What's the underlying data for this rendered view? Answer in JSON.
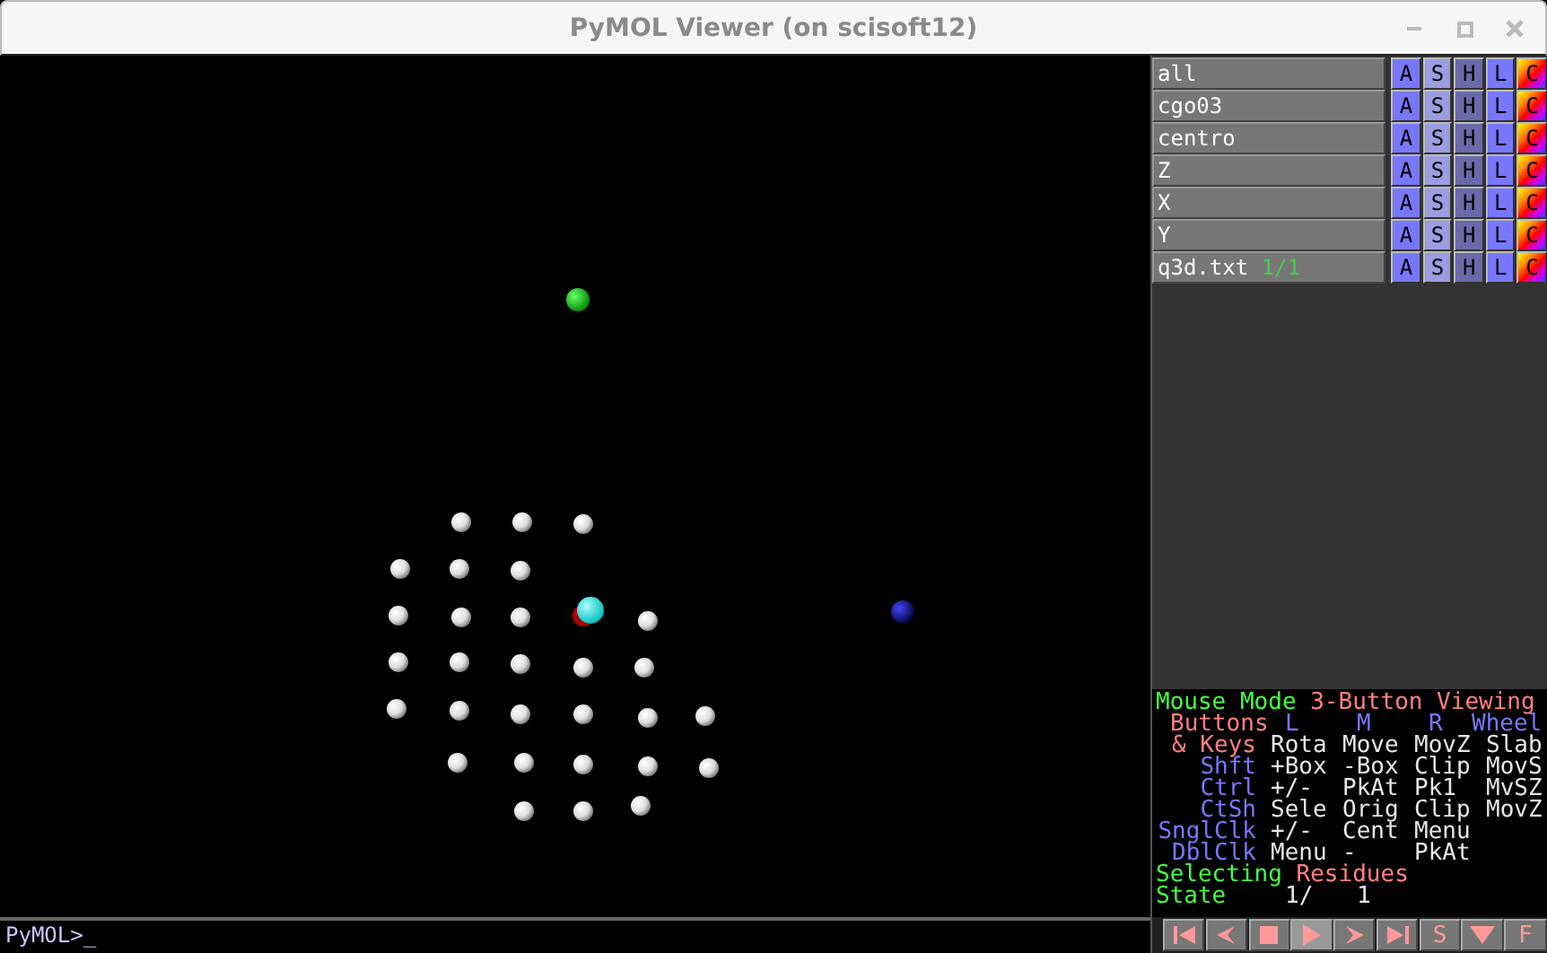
{
  "window": {
    "title": "PyMOL Viewer (on scisoft12)"
  },
  "objects": [
    {
      "name": "all",
      "buttons": [
        {
          "label": "A",
          "kind": "action"
        },
        {
          "label": "S",
          "kind": "show"
        },
        {
          "label": "H",
          "kind": "hide"
        },
        {
          "label": "L",
          "kind": "label"
        },
        {
          "label": "C",
          "kind": "color"
        }
      ]
    },
    {
      "name": "cgo03",
      "buttons": [
        {
          "label": "A",
          "kind": "action"
        },
        {
          "label": "S",
          "kind": "show"
        },
        {
          "label": "H",
          "kind": "hide"
        },
        {
          "label": "L",
          "kind": "label"
        },
        {
          "label": "C",
          "kind": "color"
        }
      ]
    },
    {
      "name": "centro",
      "buttons": [
        {
          "label": "A",
          "kind": "action"
        },
        {
          "label": "S",
          "kind": "show"
        },
        {
          "label": "H",
          "kind": "hide"
        },
        {
          "label": "L",
          "kind": "label"
        },
        {
          "label": "C",
          "kind": "color"
        }
      ]
    },
    {
      "name": "Z",
      "buttons": [
        {
          "label": "A",
          "kind": "action"
        },
        {
          "label": "S",
          "kind": "show"
        },
        {
          "label": "H",
          "kind": "hide"
        },
        {
          "label": "L",
          "kind": "label"
        },
        {
          "label": "C",
          "kind": "color"
        }
      ]
    },
    {
      "name": "X",
      "buttons": [
        {
          "label": "A",
          "kind": "action"
        },
        {
          "label": "S",
          "kind": "show"
        },
        {
          "label": "H",
          "kind": "hide"
        },
        {
          "label": "L",
          "kind": "label"
        },
        {
          "label": "C",
          "kind": "color"
        }
      ]
    },
    {
      "name": "Y",
      "buttons": [
        {
          "label": "A",
          "kind": "action"
        },
        {
          "label": "S",
          "kind": "show"
        },
        {
          "label": "H",
          "kind": "hide"
        },
        {
          "label": "L",
          "kind": "label"
        },
        {
          "label": "C",
          "kind": "color"
        }
      ]
    },
    {
      "name": "q3d.txt",
      "state": "1/1",
      "buttons": [
        {
          "label": "A",
          "kind": "action"
        },
        {
          "label": "S",
          "kind": "show"
        },
        {
          "label": "H",
          "kind": "hide"
        },
        {
          "label": "L",
          "kind": "label"
        },
        {
          "label": "C",
          "kind": "color"
        }
      ]
    }
  ],
  "mouse_mode": {
    "title": "Mouse Mode",
    "mode": "3-Button Viewing",
    "header": {
      "label": "Buttons",
      "columns": [
        "L",
        "M",
        "R",
        "Wheel"
      ]
    },
    "rows": [
      {
        "modifier": "& Keys",
        "kind": "keys",
        "actions": [
          "Rota",
          "Move",
          "MovZ",
          "Slab"
        ]
      },
      {
        "modifier": "Shft",
        "kind": "modifier",
        "actions": [
          "+Box",
          "-Box",
          "Clip",
          "MovS"
        ]
      },
      {
        "modifier": "Ctrl",
        "kind": "modifier",
        "actions": [
          "+/-",
          "PkAt",
          "Pk1",
          "MvSZ"
        ]
      },
      {
        "modifier": "CtSh",
        "kind": "modifier",
        "actions": [
          "Sele",
          "Orig",
          "Clip",
          "MovZ"
        ]
      },
      {
        "modifier": "SnglClk",
        "kind": "modifier",
        "actions": [
          "+/-",
          "Cent",
          "Menu"
        ]
      },
      {
        "modifier": "DblClk",
        "kind": "modifier",
        "actions": [
          "Menu",
          "-",
          "PkAt"
        ]
      }
    ],
    "selecting_label": "Selecting",
    "selecting_value": "Residues",
    "state_label": "State",
    "state_current": "1/",
    "state_total": "1"
  },
  "playback_buttons": [
    {
      "kind": "first",
      "selected": false
    },
    {
      "kind": "back",
      "selected": false
    },
    {
      "kind": "stop",
      "selected": false
    },
    {
      "kind": "play",
      "selected": true
    },
    {
      "kind": "forward",
      "selected": false
    },
    {
      "kind": "last",
      "selected": false
    },
    {
      "kind": "text",
      "label": "S",
      "selected": false
    },
    {
      "kind": "down",
      "selected": false
    },
    {
      "kind": "text",
      "label": "F",
      "selected": false
    }
  ],
  "command_line": {
    "value": "PyMOL>_"
  }
}
